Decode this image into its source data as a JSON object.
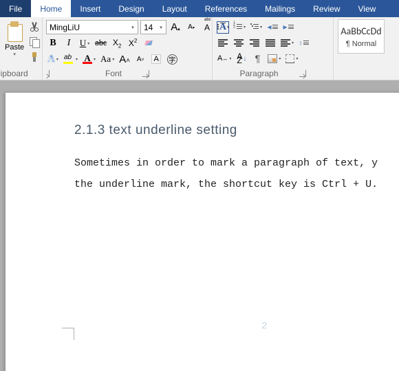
{
  "tabs": {
    "file": "File",
    "home": "Home",
    "insert": "Insert",
    "design": "Design",
    "layout": "Layout",
    "references": "References",
    "mailings": "Mailings",
    "review": "Review",
    "view": "View"
  },
  "clipboard": {
    "paste": "Paste",
    "label": "Clipboard"
  },
  "font": {
    "name": "MingLiU",
    "size": "14",
    "grow": "A",
    "shrink": "A",
    "case": "Aa",
    "clear": "A",
    "bold": "B",
    "italic": "I",
    "underline": "U",
    "strike": "abc",
    "sub_base": "X",
    "sub_s": "2",
    "sup_base": "X",
    "sup_s": "2",
    "effects": "A",
    "highlight": "ab",
    "color": "A",
    "enclose": "字",
    "charfmt": "A",
    "label": "Font"
  },
  "para": {
    "sort": "A Z",
    "pilcrow": "¶",
    "label": "Paragraph"
  },
  "styles": {
    "sample": "AaBbCcDd",
    "name": "¶ Normal"
  },
  "doc": {
    "heading": "2.1.3 text underline setting",
    "line1": "Sometimes in order to mark a paragraph of text, y",
    "line2": "the underline mark, the shortcut key is Ctrl + U.",
    "page_number": "2"
  }
}
